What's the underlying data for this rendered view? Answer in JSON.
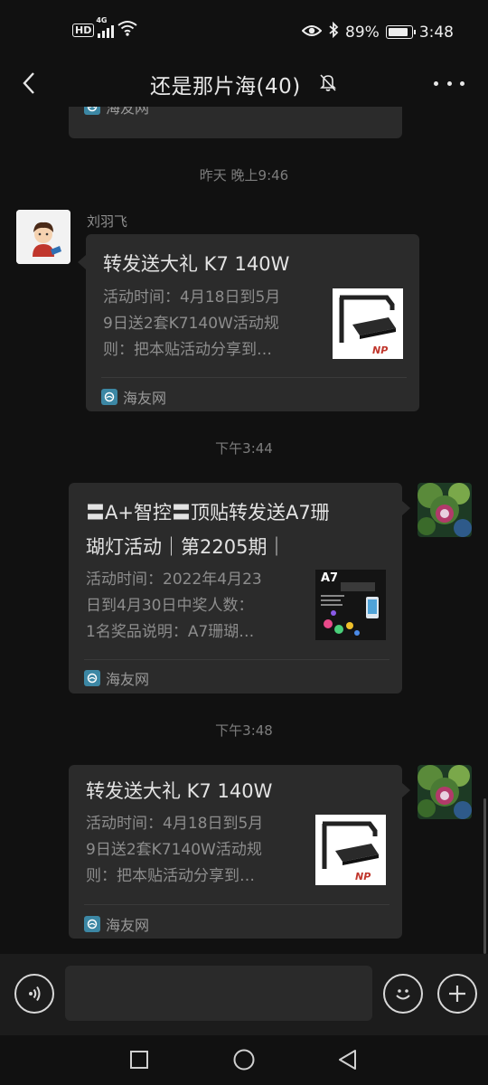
{
  "status_bar": {
    "hd": "HD",
    "network": "4G",
    "battery_percent": "89%",
    "battery_level": 0.89,
    "time": "3:48"
  },
  "header": {
    "title": "还是那片海(40)",
    "icons": [
      "back-arrow-icon",
      "mute-bell-icon",
      "more-icon"
    ]
  },
  "messages": [
    {
      "type": "card-partial",
      "source": "海友网"
    },
    {
      "type": "time",
      "text": "昨天 晚上9:46"
    },
    {
      "type": "card",
      "sender": "刘羽飞",
      "title": "转发送大礼 K7 140W",
      "desc": [
        "活动时间：4月18日到5月",
        "9日送2套K7140W活动规",
        "则：把本贴活动分享到…"
      ],
      "source": "海友网"
    },
    {
      "type": "time",
      "text": "下午3:44"
    },
    {
      "type": "card",
      "title": [
        "〓A+智控〓顶贴转发送A7珊",
        "瑚灯活动｜第2205期｜"
      ],
      "desc": [
        "活动时间：2022年4月23",
        "日到4月30日中奖人数：",
        "1名奖品说明：A7珊瑚…"
      ],
      "thumb_label": "A7",
      "source": "海友网"
    },
    {
      "type": "time",
      "text": "下午3:48"
    },
    {
      "type": "card",
      "title": "转发送大礼 K7 140W",
      "desc": [
        "活动时间：4月18日到5月",
        "9日送2套K7140W活动规",
        "则：把本贴活动分享到…"
      ],
      "source": "海友网"
    }
  ],
  "input_bar": {
    "icons": [
      "voice-icon",
      "emoji-icon",
      "plus-icon"
    ],
    "placeholder": ""
  },
  "nav_bar": {
    "icons": [
      "recent-apps-icon",
      "home-icon",
      "back-icon"
    ]
  },
  "colors": {
    "background": "#111111",
    "card": "#2b2b2b",
    "source_logo": "#3c87a4"
  }
}
